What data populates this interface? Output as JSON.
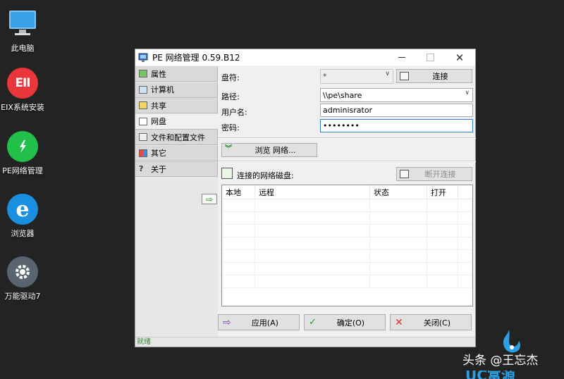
{
  "desktop": {
    "icons": [
      {
        "label": "此电脑",
        "icon": "computer-icon"
      },
      {
        "label": "EIX系统安装",
        "icon": "eix-installer-icon",
        "glyph": "EII"
      },
      {
        "label": "PE网络管理",
        "icon": "pe-network-icon"
      },
      {
        "label": "浏览器",
        "icon": "browser-icon",
        "glyph": "e"
      },
      {
        "label": "万能驱动7",
        "icon": "gear-icon"
      }
    ]
  },
  "window": {
    "title": "PE 网络管理 0.59.B12",
    "close_glyph": "✕"
  },
  "sidebar": {
    "items": [
      {
        "label": "属性",
        "icon": "properties-icon"
      },
      {
        "label": "计算机",
        "icon": "computer-icon"
      },
      {
        "label": "共享",
        "icon": "share-folder-icon"
      },
      {
        "label": "网盘",
        "icon": "network-drive-icon",
        "active": true
      },
      {
        "label": "文件和配置文件",
        "icon": "document-icon"
      },
      {
        "label": "其它",
        "icon": "other-icon"
      },
      {
        "label": "关于",
        "icon": "question-icon",
        "glyph": "?"
      }
    ],
    "arrow_glyph": "⇨"
  },
  "form": {
    "drive_label": "盘符:",
    "drive_value": "*",
    "connect_label": "连接",
    "path_label": "路径:",
    "path_value": "\\\\pe\\share",
    "user_label": "用户名:",
    "user_value": "adminisrator",
    "password_label": "密码:",
    "password_value": "••••••••",
    "browse_label": "浏览 网络...",
    "connected_label": "连接的网络磁盘:",
    "disconnect_label": "断开连接",
    "chevron_glyph": "∨"
  },
  "table": {
    "columns": [
      "本地",
      "远程",
      "状态",
      "打开"
    ],
    "empty_rows": 7
  },
  "footer": {
    "apply_label": "应用(A)",
    "ok_label": "确定(O)",
    "close_label": "关闭(C)",
    "apply_glyph": "⇨",
    "ok_glyph": "✓",
    "close_glyph": "✕"
  },
  "status": {
    "text": "就绪"
  },
  "watermark": {
    "text": "头条 @王忘杰",
    "partial": "UC富源"
  }
}
